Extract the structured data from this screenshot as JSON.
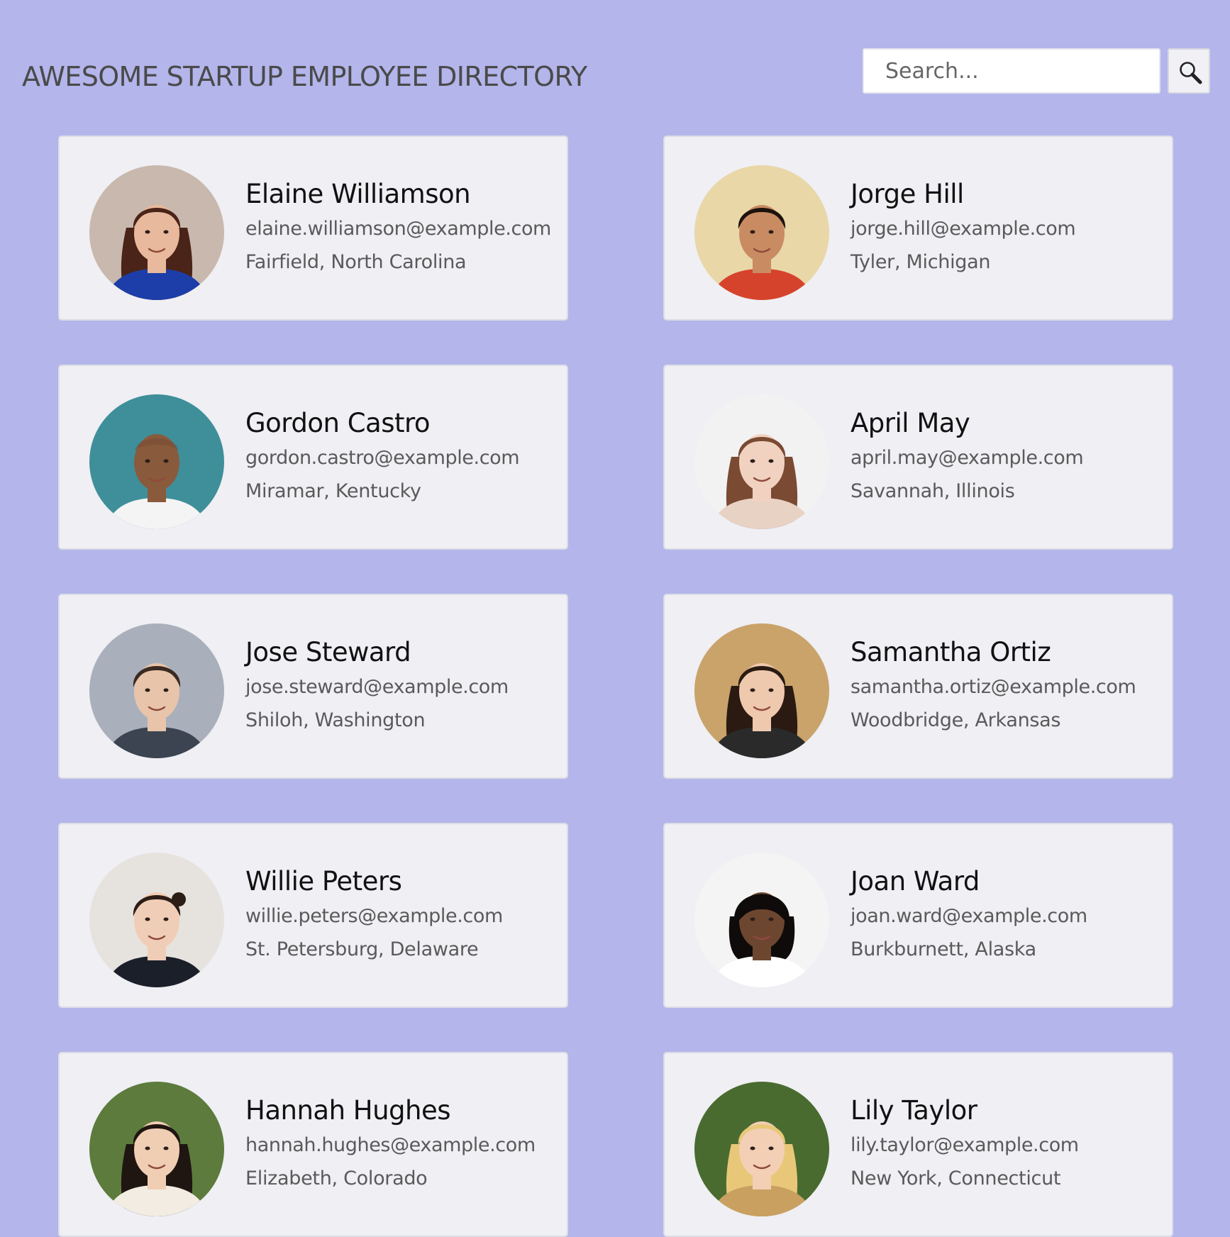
{
  "header": {
    "title": "AWESOME STARTUP EMPLOYEE DIRECTORY",
    "search": {
      "placeholder": "Search...",
      "value": "",
      "button_icon": "magnifier-icon"
    }
  },
  "colors": {
    "page_background": "#b3b5eb",
    "card_background": "#efeff4",
    "card_border": "#dcdce6",
    "name_text": "#111111",
    "detail_text": "#5a5a5a"
  },
  "employees": [
    {
      "name": "Elaine Williamson",
      "email": "elaine.williamson@example.com",
      "location": "Fairfield, North Carolina",
      "photo": {
        "bg": "#c9b8ad",
        "skin": "#e8b99c",
        "hair": "#4a2418",
        "shirt": "#1d3ea8",
        "hair_style": "long"
      }
    },
    {
      "name": "Jorge Hill",
      "email": "jorge.hill@example.com",
      "location": "Tyler, Michigan",
      "photo": {
        "bg": "#e9d7a8",
        "skin": "#c98b62",
        "hair": "#1c120c",
        "shirt": "#d6432c",
        "hair_style": "short"
      }
    },
    {
      "name": "Gordon Castro",
      "email": "gordon.castro@example.com",
      "location": "Miramar, Kentucky",
      "photo": {
        "bg": "#3f8f9a",
        "skin": "#8a5a3c",
        "hair": "#6a4530",
        "shirt": "#f4f4f4",
        "hair_style": "bald"
      }
    },
    {
      "name": "April May",
      "email": "april.may@example.com",
      "location": "Savannah, Illinois",
      "photo": {
        "bg": "#f2f2f2",
        "skin": "#f1d2c1",
        "hair": "#7a4a32",
        "shirt": "#e8d2c4",
        "hair_style": "long"
      }
    },
    {
      "name": "Jose Steward",
      "email": "jose.steward@example.com",
      "location": "Shiloh, Washington",
      "photo": {
        "bg": "#a9b0bb",
        "skin": "#e8c4aa",
        "hair": "#3a2a22",
        "shirt": "#3b4450",
        "hair_style": "short"
      }
    },
    {
      "name": "Samantha Ortiz",
      "email": "samantha.ortiz@example.com",
      "location": "Woodbridge, Arkansas",
      "photo": {
        "bg": "#c9a36a",
        "skin": "#efc9ae",
        "hair": "#2a1a12",
        "shirt": "#2a2a2a",
        "hair_style": "long"
      }
    },
    {
      "name": "Willie Peters",
      "email": "willie.peters@example.com",
      "location": "St. Petersburg, Delaware",
      "photo": {
        "bg": "#e6e3df",
        "skin": "#f0cdb6",
        "hair": "#2c1d16",
        "shirt": "#1b1f2a",
        "hair_style": "tied"
      }
    },
    {
      "name": "Joan Ward",
      "email": "joan.ward@example.com",
      "location": "Burkburnett, Alaska",
      "photo": {
        "bg": "#f4f4f4",
        "skin": "#6d4630",
        "hair": "#0e0b0a",
        "shirt": "#ffffff",
        "hair_style": "bob"
      }
    },
    {
      "name": "Hannah Hughes",
      "email": "hannah.hughes@example.com",
      "location": "Elizabeth, Colorado",
      "photo": {
        "bg": "#5c7b3c",
        "skin": "#f0ceb4",
        "hair": "#1f1511",
        "shirt": "#f3ece2",
        "hair_style": "long"
      }
    },
    {
      "name": "Lily Taylor",
      "email": "lily.taylor@example.com",
      "location": "New York, Connecticut",
      "photo": {
        "bg": "#4a6b2f",
        "skin": "#f2cfb5",
        "hair": "#e8c878",
        "shirt": "#c9a060",
        "hair_style": "long"
      }
    }
  ]
}
